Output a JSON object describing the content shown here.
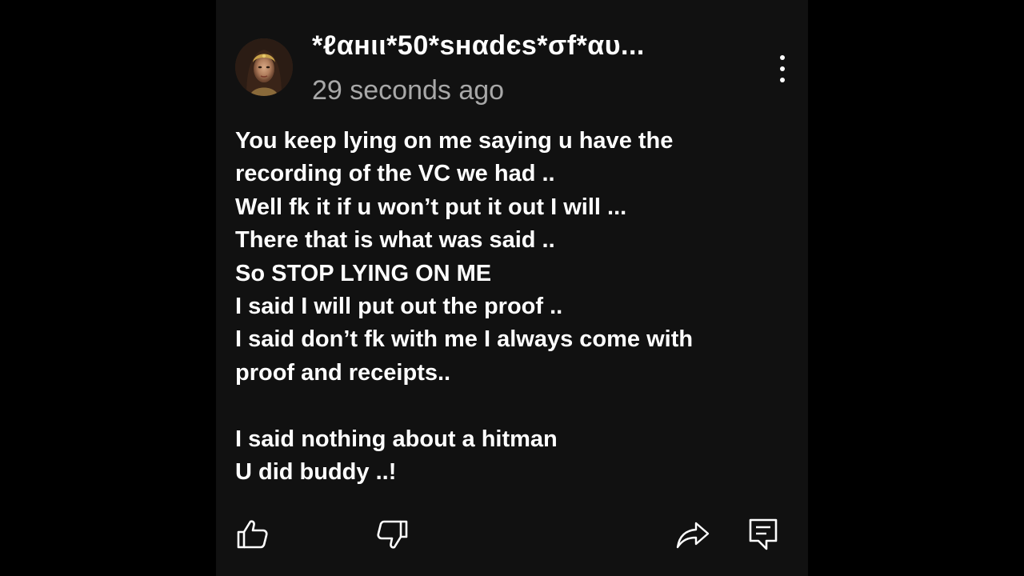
{
  "comment": {
    "author": "*ℓαнιι*50*sнαdєs*σf*αυ...",
    "timestamp": "29 seconds ago",
    "avatar_icon": "avatar-portrait",
    "lines": [
      "You keep lying on me saying u have the",
      "recording of the VC we had ..",
      "Well fk it if u won’t put it out I will ...",
      "There that is what was said ..",
      "So STOP LYING ON ME",
      "I said I will put out the proof ..",
      "I said don’t fk with me I always come with",
      "proof and receipts..",
      "",
      "I said nothing about a hitman",
      "U did buddy ..!"
    ]
  },
  "actions": {
    "like_icon": "thumbs-up-icon",
    "dislike_icon": "thumbs-down-icon",
    "share_icon": "share-icon",
    "reply_icon": "reply-icon",
    "more_icon": "more-vertical-icon"
  },
  "colors": {
    "page_background": "#000000",
    "panel_background": "#111111",
    "text_primary": "#ffffff",
    "text_secondary": "#a8a8a8"
  }
}
